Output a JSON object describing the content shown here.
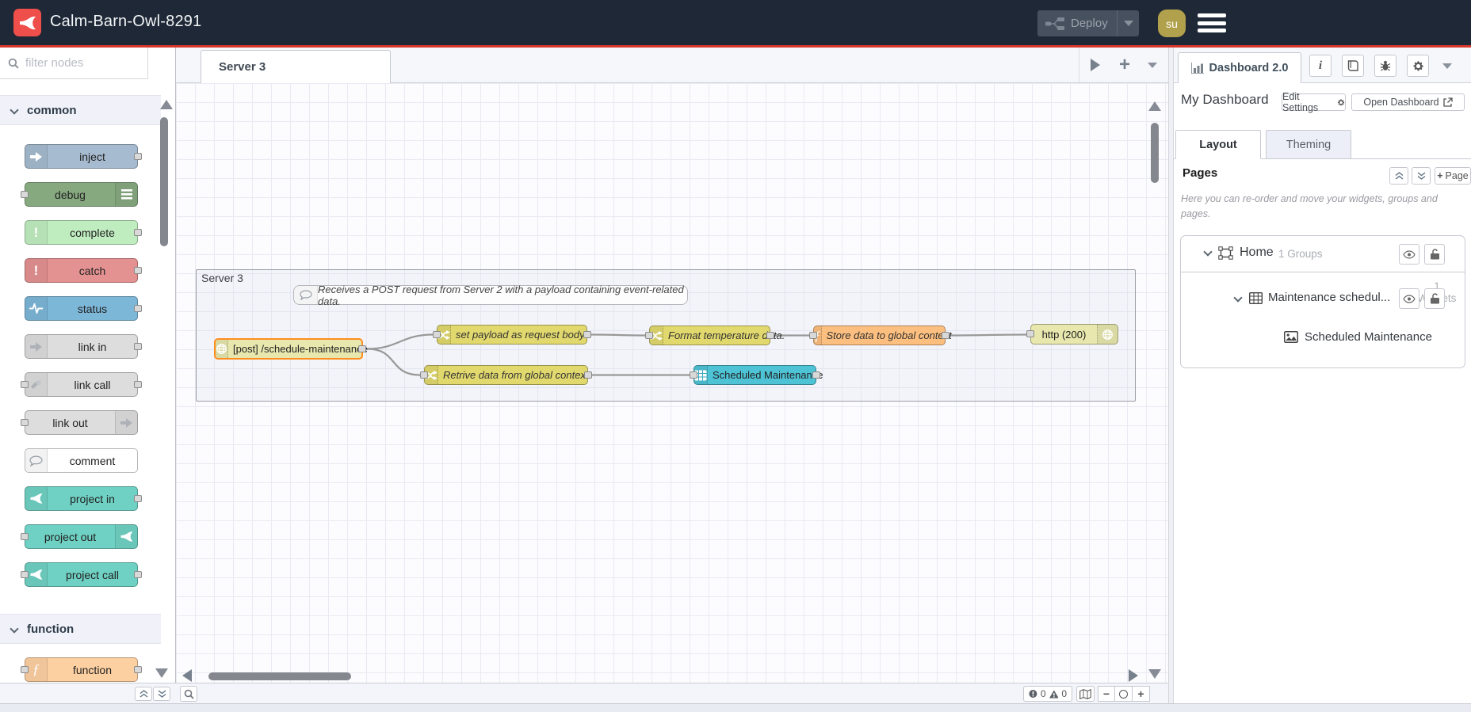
{
  "colors": {
    "header-bg": "#1e2836",
    "accent-red": "#d5372c",
    "logo-red": "#ee4f4a",
    "deploy-bg": "#46505f",
    "deploy-text": "#9aa1ab",
    "avatar-bg": "#b2a14c",
    "canvas-bg": "#fcfcfe",
    "grid-line": "#e9eaf2",
    "wire": "#999999",
    "selected": "#ff8e1e",
    "node-inject": "#a6bbcf",
    "node-debug": "#87a980",
    "node-complete": "#c0edc0",
    "node-catch": "#e49191",
    "node-status": "#7db7d8",
    "node-link": "#dddddd",
    "node-project": "#6fd1c3",
    "node-function": "#fdd0a2",
    "node-change": "#e2d96e",
    "node-http": "#e7e7ae",
    "node-function-flow": "#fdbf7f",
    "node-table": "#4ec3d6"
  },
  "header": {
    "title": "Calm-Barn-Owl-8291",
    "deploy_label": "Deploy",
    "avatar": "su"
  },
  "palette": {
    "search_placeholder": "filter nodes",
    "categories": [
      {
        "label": "common",
        "items": [
          {
            "label": "inject"
          },
          {
            "label": "debug"
          },
          {
            "label": "complete"
          },
          {
            "label": "catch"
          },
          {
            "label": "status"
          },
          {
            "label": "link in"
          },
          {
            "label": "link call"
          },
          {
            "label": "link out"
          },
          {
            "label": "comment"
          },
          {
            "label": "project in"
          },
          {
            "label": "project out"
          },
          {
            "label": "project call"
          }
        ]
      },
      {
        "label": "function",
        "items": [
          {
            "label": "function"
          }
        ]
      }
    ]
  },
  "workspace": {
    "tab_label": "Server 3",
    "group_label": "Server 3",
    "comment_text": "Receives a POST request from Server 2 with a payload containing event-related data.",
    "nodes": {
      "http_in": "[post] /schedule-maintenance",
      "set_payload": "set payload as request body",
      "retrieve": "Retrive data from global context",
      "format": "Format temperature data.",
      "store": "Store data to global context",
      "http_response": "http (200)",
      "table": "Scheduled Maintenance"
    },
    "status": {
      "errors": "0",
      "warnings": "0"
    }
  },
  "sidebar": {
    "tab_label": "Dashboard 2.0",
    "dashboard_name": "My Dashboard",
    "edit_settings_label": "Edit Settings",
    "open_dashboard_label": "Open Dashboard",
    "layout_tab": "Layout",
    "theming_tab": "Theming",
    "pages_heading": "Pages",
    "add_page_label": "Page",
    "description": "Here you can re-order and move your widgets, groups and pages.",
    "tree": {
      "page_label": "Home",
      "page_meta": "1 Groups",
      "group_label": "Maintenance schedul...",
      "group_meta": "1 Widgets",
      "widget_label": "Scheduled Maintenance"
    }
  }
}
